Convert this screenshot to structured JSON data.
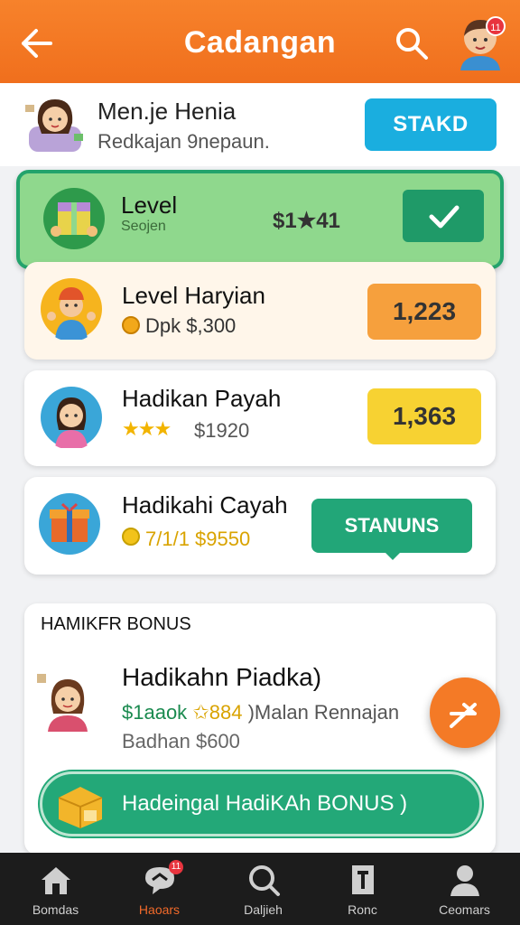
{
  "header": {
    "title": "Cadangan",
    "notification_count": "11"
  },
  "user": {
    "name": "Men.je Henia",
    "subtitle": "Redkajan 9nepaun.",
    "stake_label": "STAKD"
  },
  "cards": [
    {
      "title": "Level",
      "subtitle": "Seojen",
      "amount": "$1★41",
      "action": "check"
    },
    {
      "title": "Level Haryian",
      "subtitle": "Dpk  $,300",
      "amount": "1,223"
    },
    {
      "title": "Hadikan Payah",
      "subtitle": "$1920",
      "amount": "1,363"
    },
    {
      "title": "Hadikahi Cayah",
      "subtitle": "7/1/1  $9550",
      "status": "STANUNS"
    }
  ],
  "bonus": {
    "heading": "HAMIKFR BONUS",
    "title": "Hadikahn Piadka)",
    "line_green": "$1aaok",
    "line_yellow": "✩884",
    "line_rest": ")Malan Rennajan",
    "subtitle": "Badhan $600",
    "button_label": "Hadeingal HadiKAh BONUS )"
  },
  "nav": [
    {
      "label": "Bomdas",
      "icon": "home-icon"
    },
    {
      "label": "Haoars",
      "icon": "chat-icon",
      "badge": "11"
    },
    {
      "label": "Daljieh",
      "icon": "search-icon"
    },
    {
      "label": "Ronc",
      "icon": "document-icon"
    },
    {
      "label": "Ceomars",
      "icon": "profile-icon"
    }
  ],
  "colors": {
    "header": "#f06f1d",
    "accent_green": "#23a36c",
    "accent_blue": "#1aaedf",
    "nav_active": "#f26a2a"
  }
}
